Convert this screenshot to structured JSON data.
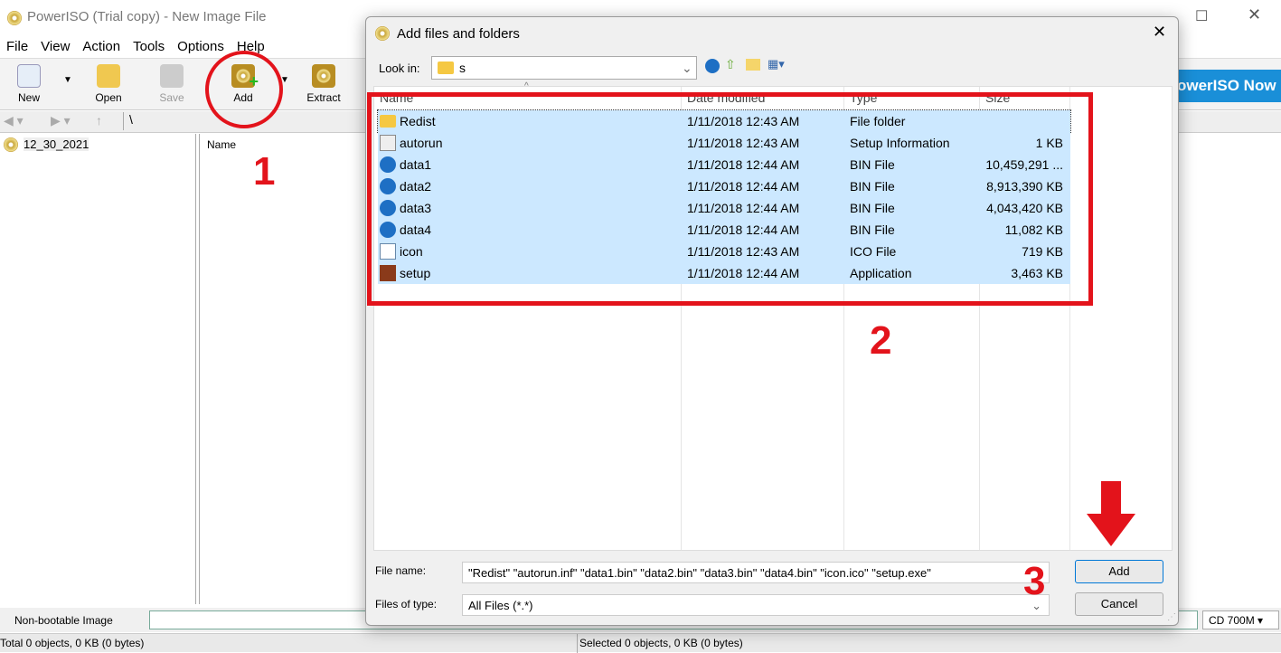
{
  "window": {
    "title": "PowerISO (Trial copy) - New Image File"
  },
  "menu": [
    "File",
    "View",
    "Action",
    "Tools",
    "Options",
    "Help"
  ],
  "toolbar": {
    "new": "New",
    "open": "Open",
    "save": "Save",
    "add": "Add",
    "extract": "Extract",
    "buy": "owerISO Now"
  },
  "nav": {
    "path": "\\"
  },
  "tree": {
    "root": "12_30_2021"
  },
  "pane": {
    "name_col": "Name"
  },
  "status": {
    "boot": "Non-bootable Image",
    "media": "CD 700M",
    "total": "Total 0 objects, 0 KB (0 bytes)",
    "selected": "Selected 0 objects, 0 KB (0 bytes)"
  },
  "dialog": {
    "title": "Add files and folders",
    "look_in_label": "Look in:",
    "look_in_value": "s",
    "columns": [
      "Name",
      "Date modified",
      "Type",
      "Size"
    ],
    "files": [
      {
        "name": "Redist",
        "date": "1/11/2018 12:43 AM",
        "type": "File folder",
        "size": "",
        "icon": "folder"
      },
      {
        "name": "autorun",
        "date": "1/11/2018 12:43 AM",
        "type": "Setup Information",
        "size": "1 KB",
        "icon": "setup-info"
      },
      {
        "name": "data1",
        "date": "1/11/2018 12:44 AM",
        "type": "BIN File",
        "size": "10,459,291 ...",
        "icon": "bin"
      },
      {
        "name": "data2",
        "date": "1/11/2018 12:44 AM",
        "type": "BIN File",
        "size": "8,913,390 KB",
        "icon": "bin"
      },
      {
        "name": "data3",
        "date": "1/11/2018 12:44 AM",
        "type": "BIN File",
        "size": "4,043,420 KB",
        "icon": "bin"
      },
      {
        "name": "data4",
        "date": "1/11/2018 12:44 AM",
        "type": "BIN File",
        "size": "11,082 KB",
        "icon": "bin"
      },
      {
        "name": "icon",
        "date": "1/11/2018 12:43 AM",
        "type": "ICO File",
        "size": "719 KB",
        "icon": "ico"
      },
      {
        "name": "setup",
        "date": "1/11/2018 12:44 AM",
        "type": "Application",
        "size": "3,463 KB",
        "icon": "app"
      }
    ],
    "file_name_label": "File name:",
    "file_name_value": "\"Redist\" \"autorun.inf\" \"data1.bin\" \"data2.bin\" \"data3.bin\" \"data4.bin\" \"icon.ico\" \"setup.exe\"",
    "file_type_label": "Files of type:",
    "file_type_value": "All Files (*.*)",
    "add": "Add",
    "cancel": "Cancel"
  },
  "annotations": {
    "step1": "1",
    "step2": "2",
    "step3": "3"
  }
}
